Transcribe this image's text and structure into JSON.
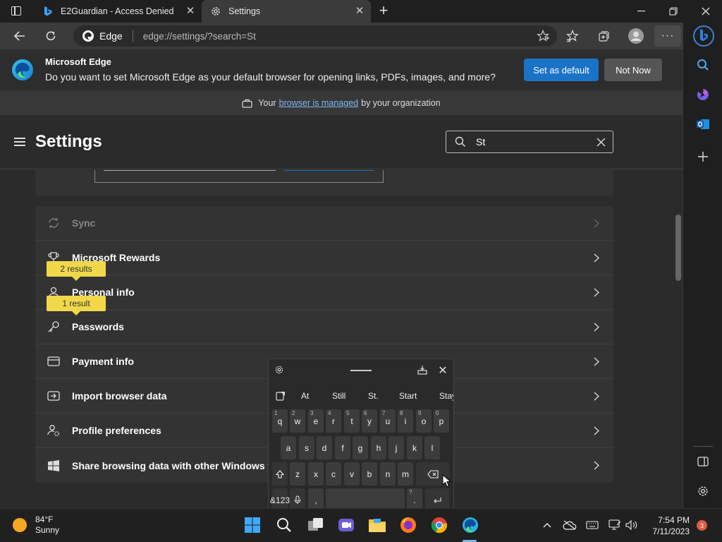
{
  "tabs": [
    {
      "title": "E2Guardian - Access Denied",
      "icon": "bing-icon"
    },
    {
      "title": "Settings",
      "icon": "gear-icon",
      "active": true
    }
  ],
  "window_controls": {
    "minimize": "—",
    "restore": "❐",
    "close": "✕"
  },
  "address_bar": {
    "site_label": "Edge",
    "url": "edge://settings/?search=St"
  },
  "infobar": {
    "title": "Microsoft Edge",
    "message": "Do you want to set Microsoft Edge as your default browser for opening links, PDFs, images, and more?",
    "set_default_label": "Set as default",
    "not_now_label": "Not Now"
  },
  "managed": {
    "prefix": "Your",
    "link": "browser is managed",
    "suffix": "by your organization"
  },
  "settings": {
    "title": "Settings",
    "search_value": "St"
  },
  "rows": [
    {
      "label": "Sync",
      "icon": "sync-icon",
      "dim": true
    },
    {
      "label": "Microsoft Rewards",
      "icon": "trophy-icon"
    },
    {
      "label": "Personal info",
      "icon": "person-icon"
    },
    {
      "label": "Passwords",
      "icon": "key-icon"
    },
    {
      "label": "Payment info",
      "icon": "card-icon"
    },
    {
      "label": "Import browser data",
      "icon": "import-icon"
    },
    {
      "label": "Profile preferences",
      "icon": "profile-settings-icon"
    },
    {
      "label": "Share browsing data with other Windows features",
      "icon": "windows-icon"
    }
  ],
  "badges": [
    {
      "text": "2 results"
    },
    {
      "text": "1 result"
    }
  ],
  "keyboard": {
    "suggestions": [
      "At",
      "Still",
      "St.",
      "Start",
      "Stay"
    ],
    "row1": [
      [
        "q",
        "1"
      ],
      [
        "w",
        "2"
      ],
      [
        "e",
        "3"
      ],
      [
        "r",
        "4"
      ],
      [
        "t",
        "5"
      ],
      [
        "y",
        "6"
      ],
      [
        "u",
        "7"
      ],
      [
        "i",
        "8"
      ],
      [
        "o",
        "9"
      ],
      [
        "p",
        "0"
      ]
    ],
    "row2": [
      "a",
      "s",
      "d",
      "f",
      "g",
      "h",
      "j",
      "k",
      "l"
    ],
    "row3": [
      "z",
      "x",
      "c",
      "v",
      "b",
      "n",
      "m"
    ],
    "symbols_label": "&123",
    "comma": ",",
    "period": ".",
    "question": "?"
  },
  "taskbar": {
    "weather_temp": "84°F",
    "weather_desc": "Sunny",
    "time": "7:54 PM",
    "date": "7/11/2023",
    "notifications": "3"
  }
}
